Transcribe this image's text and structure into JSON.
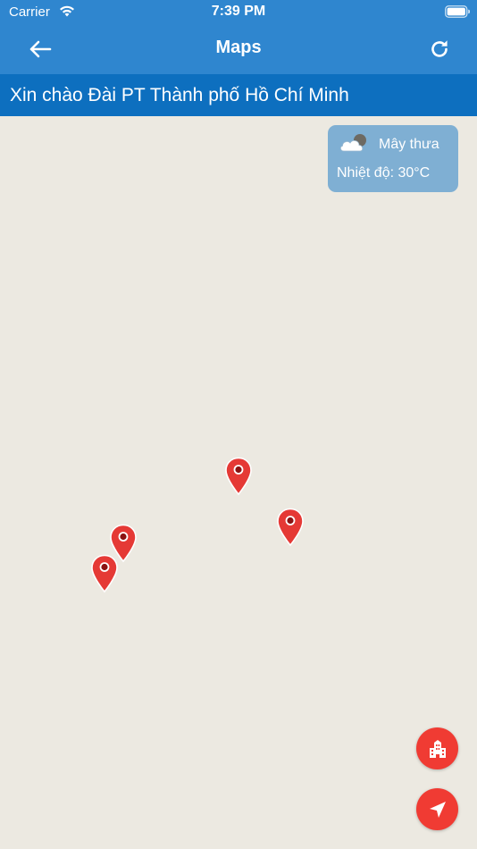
{
  "status_bar": {
    "carrier": "Carrier",
    "time": "7:39 PM",
    "icons": [
      "wifi-icon",
      "battery-icon"
    ]
  },
  "nav": {
    "title": "Maps",
    "back_icon": "arrow-left-icon",
    "refresh_icon": "refresh-icon"
  },
  "greeting": {
    "text": "Xin chào Đài PT Thành phố Hồ Chí Minh"
  },
  "weather": {
    "icon": "partly-cloudy-icon",
    "description": "Mây thưa",
    "temperature": "Nhiệt độ: 30°C"
  },
  "map": {
    "marker_count": 4,
    "marker_icon": "map-pin-icon"
  },
  "actions": [
    {
      "icon": "building-icon"
    },
    {
      "icon": "navigation-arrow-icon"
    }
  ],
  "colors": {
    "header": "#2f86cf",
    "greeting_bar": "#0d6fbf",
    "map_background": "#ece9e1",
    "marker": "#e53935",
    "fab": "#f03b33",
    "weather_card": "#7fafd3"
  }
}
